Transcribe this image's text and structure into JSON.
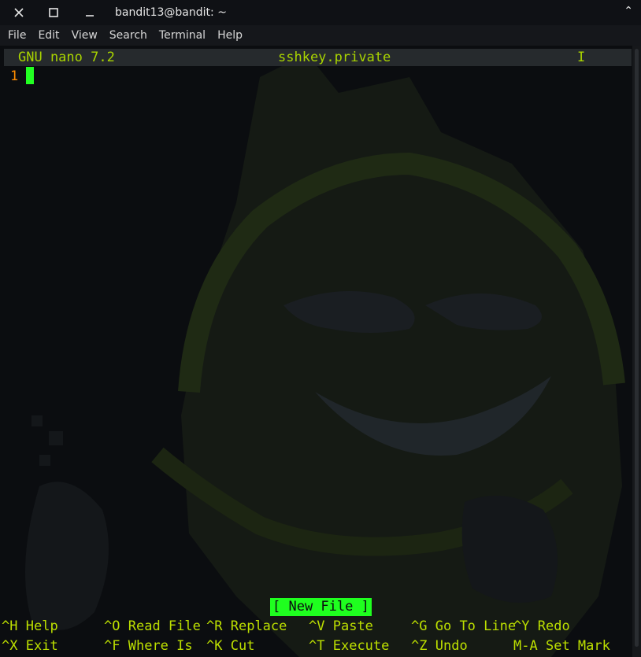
{
  "window": {
    "title": "bandit13@bandit: ~",
    "right_glyph": "⌃"
  },
  "menubar": {
    "items": [
      "File",
      "Edit",
      "View",
      "Search",
      "Terminal",
      "Help"
    ]
  },
  "nano": {
    "version": "GNU nano 7.2",
    "filename": "sshkey.private",
    "indicator": "I",
    "line_number": "1",
    "status": "[ New File ]",
    "shortcuts_row1": [
      {
        "key": "^H",
        "label": "Help"
      },
      {
        "key": "^O",
        "label": "Read File"
      },
      {
        "key": "^R",
        "label": "Replace"
      },
      {
        "key": "^V",
        "label": "Paste"
      },
      {
        "key": "^G",
        "label": "Go To Line"
      },
      {
        "key": "^Y",
        "label": "Redo"
      }
    ],
    "shortcuts_row2": [
      {
        "key": "^X",
        "label": "Exit"
      },
      {
        "key": "^F",
        "label": "Where Is"
      },
      {
        "key": "^K",
        "label": "Cut"
      },
      {
        "key": "^T",
        "label": "Execute"
      },
      {
        "key": "^Z",
        "label": "Undo"
      },
      {
        "key": "M-A",
        "label": "Set Mark"
      }
    ]
  },
  "colors": {
    "accent_green": "#22ff22",
    "header_text": "#a9d400",
    "line_number": "#ff8c00"
  }
}
